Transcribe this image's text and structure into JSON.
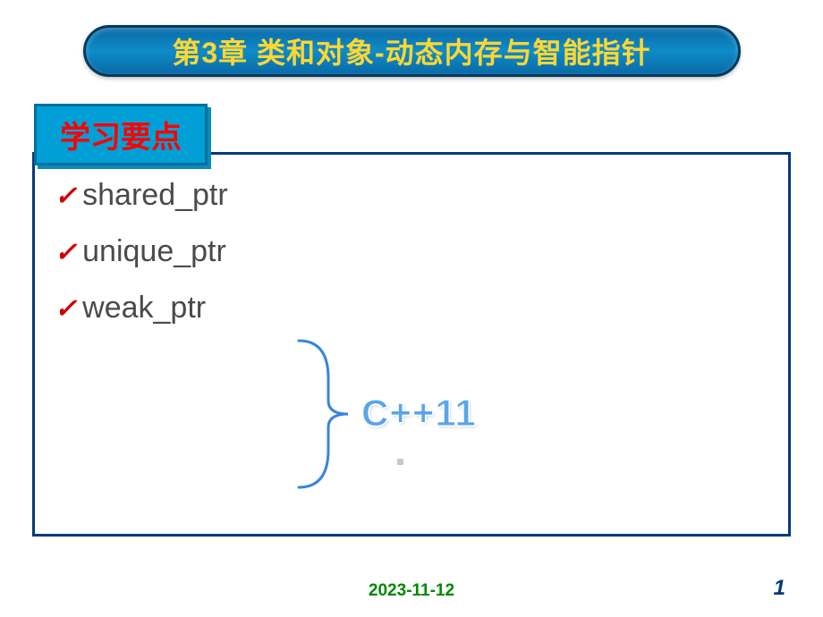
{
  "title": "第3章 类和对象-动态内存与智能指针",
  "subtitle": "学习要点",
  "bullets": [
    "shared_ptr",
    "unique_ptr",
    "weak_ptr"
  ],
  "annotation": "C++11",
  "footer": {
    "date": "2023-11-12",
    "page": "1"
  }
}
